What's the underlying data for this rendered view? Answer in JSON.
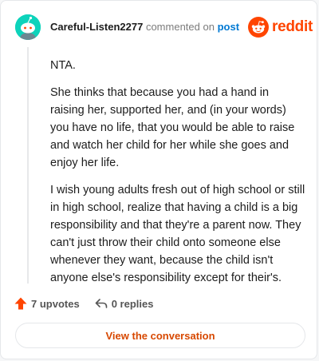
{
  "comment": {
    "username": "Careful-Listen2277",
    "commented_text": "commented on",
    "post_link": "post",
    "paragraphs": [
      "NTA.",
      "She thinks that because you had a hand in raising her, supported her, and (in your words) you have no life, that you would be able to raise and watch her child for her while she goes and enjoy her life.",
      "I wish young adults fresh out of high school or still in high school, realize that having a child is a big responsibility and that they're a parent now. They can't just throw their child onto someone else whenever they want, because the child isn't anyone else's responsibility except for their's."
    ]
  },
  "brand": {
    "name": "reddit",
    "color": "#ff4500",
    "icon": "reddit-snoo-icon"
  },
  "actions": {
    "upvotes_label": "7 upvotes",
    "replies_label": "0 replies",
    "upvote_icon": "upvote-arrow-icon",
    "reply_icon": "reply-arrow-icon"
  },
  "cta": {
    "label": "View the conversation"
  },
  "colors": {
    "avatar_bg": "#0dd3bb",
    "link": "#0079d3",
    "upvote": "#ff4500",
    "cta_text": "#d74800"
  }
}
